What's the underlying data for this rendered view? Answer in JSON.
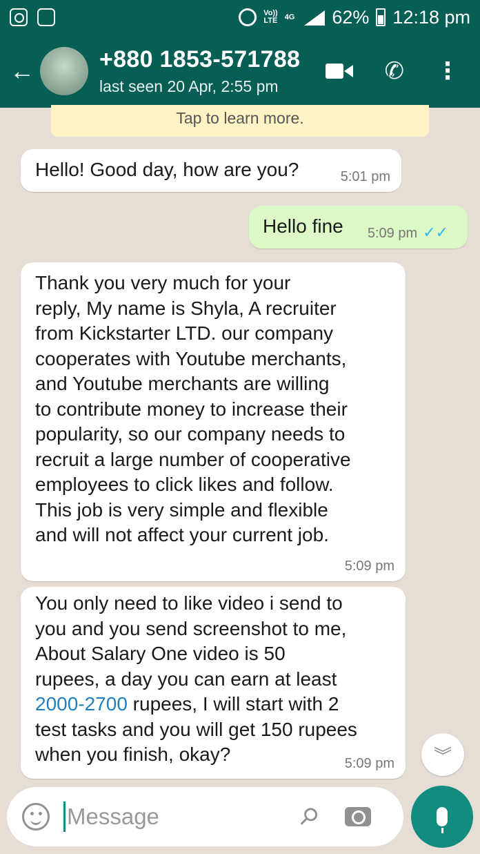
{
  "status_bar": {
    "network_label_top": "Vo))",
    "network_label_bottom": "LTE",
    "network_type": "4G",
    "battery": "62%",
    "time": "12:18 pm"
  },
  "header": {
    "contact_name": "+880 1853-571788",
    "last_seen": "last seen 20 Apr, 2:55 pm"
  },
  "notice": {
    "text": "Tap to learn more."
  },
  "messages": [
    {
      "direction": "in",
      "text": "Hello! Good day, how are you?",
      "time": "5:01 pm"
    },
    {
      "direction": "out",
      "text": "Hello fine",
      "time": "5:09 pm",
      "status": "read"
    },
    {
      "direction": "in",
      "lines": [
        "Thank you very much for your",
        "reply, My name is Shyla, A recruiter",
        "from Kickstarter LTD. our company",
        "cooperates with Youtube merchants,",
        "and Youtube merchants are willing",
        "to contribute money to increase their",
        "popularity, so our company needs to",
        "recruit a large number of cooperative",
        "employees to click likes and follow.",
        "This job is very simple and flexible",
        "and will not affect your current job."
      ],
      "time": "5:09 pm"
    },
    {
      "direction": "in",
      "lines": [
        "You only need to like video i send to",
        "you and you send screenshot to me,",
        "About Salary One video is 50",
        "rupees, a day you can earn at least"
      ],
      "highlight": "2000-2700",
      "after_highlight": " rupees, I will start with 2",
      "tail_lines": [
        "test tasks and you will get 150 rupees",
        "when you finish, okay?"
      ],
      "time": "5:09 pm"
    }
  ],
  "composer": {
    "placeholder": "Message"
  },
  "colors": {
    "header": "#075e54",
    "accent": "#128c7e",
    "outgoing_bubble": "#dcf8c6",
    "read_ticks": "#34b7f1",
    "link": "#1f7fbf"
  }
}
